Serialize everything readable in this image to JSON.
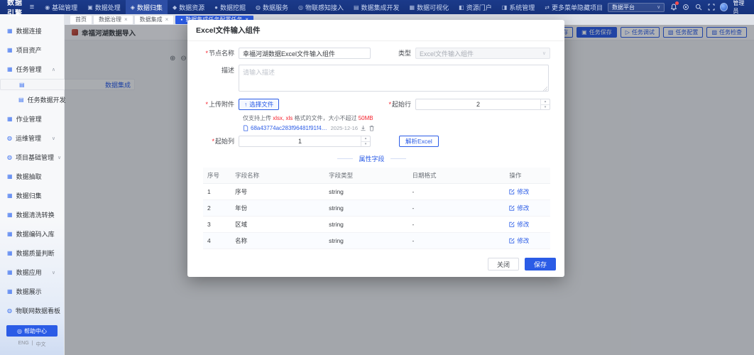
{
  "glyphs": {
    "required": "*",
    "close": "×",
    "dot": "●",
    "caret_down": "∨",
    "caret_up": "∧",
    "hamburger": "≡",
    "step_up": "▴",
    "step_down": "▾",
    "upload": "↑",
    "zoom_in": "⊕",
    "zoom_out": "⊖",
    "pipe": "|"
  },
  "navbar": {
    "logo": "数据引擎",
    "items": [
      {
        "icon": "◉",
        "label": "基础管理"
      },
      {
        "icon": "▣",
        "label": "数据处理"
      },
      {
        "icon": "◈",
        "label": "数据归集"
      },
      {
        "icon": "◆",
        "label": "数据资源"
      },
      {
        "icon": "●",
        "label": "数据挖掘"
      },
      {
        "icon": "◍",
        "label": "数据服务"
      },
      {
        "icon": "◎",
        "label": "物联感知接入"
      },
      {
        "icon": "▤",
        "label": "数据集成开发"
      },
      {
        "icon": "▦",
        "label": "数据可视化"
      },
      {
        "icon": "◧",
        "label": "资源门户"
      },
      {
        "icon": "◨",
        "label": "系统管理"
      },
      {
        "icon": "⇄",
        "label": "更多菜单隐藏项目"
      }
    ],
    "workspace_select": "数据平台",
    "user": "管理员"
  },
  "tabs": {
    "items": [
      {
        "label": "首页"
      },
      {
        "label": "数据治理"
      },
      {
        "label": "数据集成"
      },
      {
        "label": "数据集成任务配置任务"
      }
    ]
  },
  "sidebar": {
    "items": [
      {
        "icon": "▦",
        "label": "数据连接"
      },
      {
        "icon": "▦",
        "label": "项目资产"
      },
      {
        "icon": "▦",
        "label": "任务管理"
      },
      {
        "icon": "▤",
        "label": "数据集成"
      },
      {
        "icon": "▤",
        "label": "任务数据开发"
      },
      {
        "icon": "▦",
        "label": "作业管理"
      },
      {
        "icon": "◍",
        "label": "运维管理"
      },
      {
        "icon": "◍",
        "label": "项目基础管理"
      },
      {
        "icon": "▦",
        "label": "数据抽取"
      },
      {
        "icon": "▦",
        "label": "数据归集"
      },
      {
        "icon": "▦",
        "label": "数据清洗转换"
      },
      {
        "icon": "▦",
        "label": "数据编码入库"
      },
      {
        "icon": "▦",
        "label": "数据质量判断"
      },
      {
        "icon": "▦",
        "label": "数据应用"
      },
      {
        "icon": "▦",
        "label": "数据展示"
      },
      {
        "icon": "◍",
        "label": "物联网数据看板"
      }
    ],
    "help_button": {
      "icon": "◎",
      "label": "帮助中心"
    },
    "lang": {
      "left": "ENG",
      "right": "中文"
    }
  },
  "page": {
    "title": "幸福河湖数据导入",
    "toolbar": [
      {
        "icon": "▥",
        "label": "暂存"
      },
      {
        "icon": "▣",
        "label": "任务保存"
      },
      {
        "icon": "▷",
        "label": "任务调试"
      },
      {
        "icon": "▧",
        "label": "任务配置"
      },
      {
        "icon": "▨",
        "label": "任务检查"
      }
    ]
  },
  "modal": {
    "title": "Excel文件输入组件",
    "fields": {
      "node_name_label": "节点名称",
      "node_name_value": "幸福河湖数据Excel文件输入组件",
      "type_label": "类型",
      "type_value": "Excel文件输入组件",
      "desc_label": "描述",
      "desc_placeholder": "请输入描述",
      "upload_label": "上传附件",
      "upload_button": "选择文件",
      "start_row_label": "起始行",
      "start_row_value": "2",
      "start_col_label": "起始列",
      "start_col_value": "1",
      "parse_button": "解析Excel",
      "hint_prefix": "仅支持上传 ",
      "hint_formats": "xlsx, xls",
      "hint_middle": " 格式的文件，大小不超过 ",
      "hint_size": "50MB",
      "file_name": "68a43774ac283f96481f91f4.xls",
      "file_date": "2025-12-16"
    },
    "section_title": "属性字段",
    "table": {
      "headers": [
        "序号",
        "字段名称",
        "字段类型",
        "日期格式",
        "操作"
      ],
      "action_label": "修改",
      "rows": [
        {
          "no": "1",
          "name": "序号",
          "type": "string",
          "format": "-"
        },
        {
          "no": "2",
          "name": "年份",
          "type": "string",
          "format": "-"
        },
        {
          "no": "3",
          "name": "区域",
          "type": "string",
          "format": "-"
        },
        {
          "no": "4",
          "name": "名称",
          "type": "string",
          "format": "-"
        }
      ]
    },
    "footer": {
      "close": "关闭",
      "save": "保存"
    }
  }
}
